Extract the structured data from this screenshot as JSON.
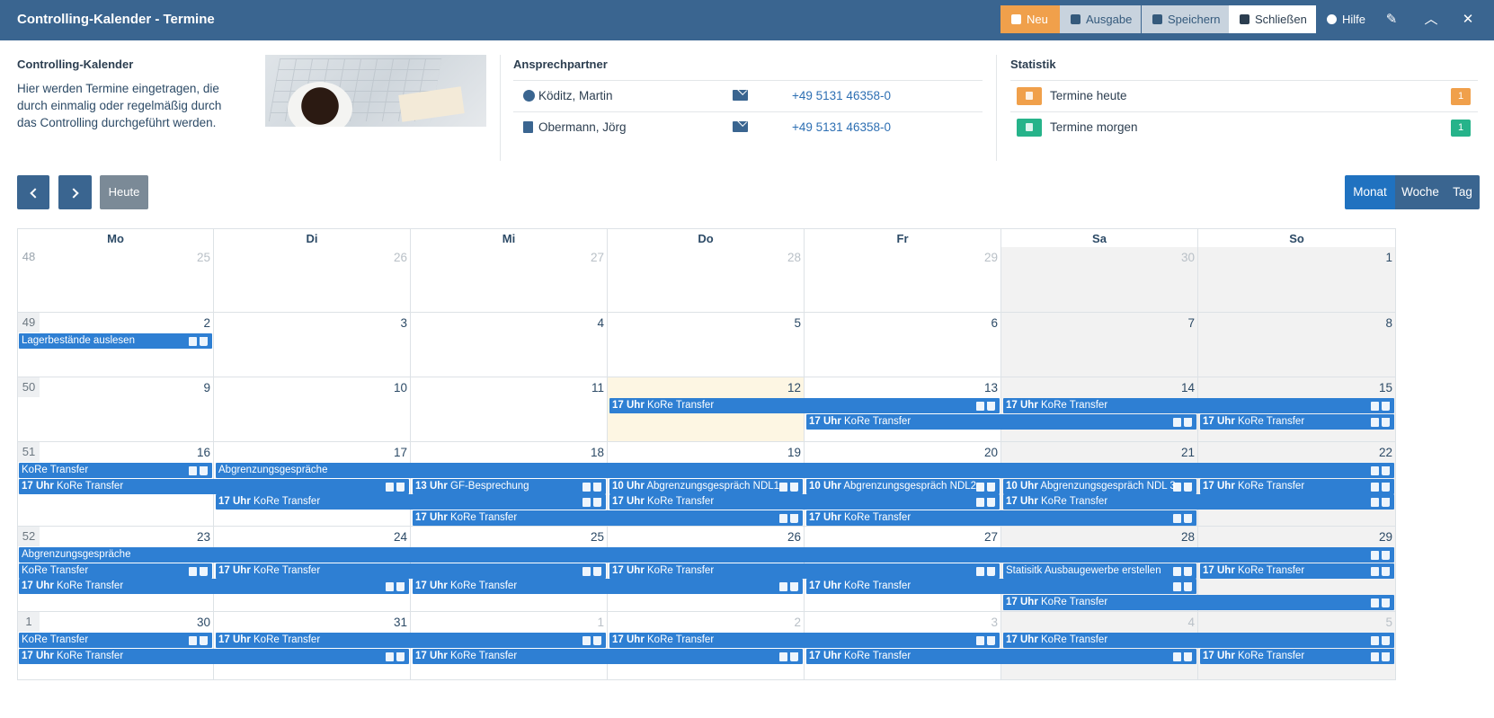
{
  "app": {
    "title": "Controlling-Kalender - Termine"
  },
  "toolbar": {
    "neu": "Neu",
    "ausgabe": "Ausgabe",
    "speichern": "Speichern",
    "schliessen": "Schließen",
    "hilfe": "Hilfe",
    "icons": [
      "pencil-icon",
      "chevron-up-icon",
      "close-icon"
    ]
  },
  "info": {
    "title": "Controlling-Kalender",
    "description": "Hier werden Termine eingetragen, die durch einmalig oder regelmäßig durch das Controlling durchgeführt werden."
  },
  "contacts": {
    "title": "Ansprechpartner",
    "items": [
      {
        "name": "Köditz, Martin",
        "phone": "+49 5131 46358-0",
        "icon": "xing-icon"
      },
      {
        "name": "Obermann, Jörg",
        "phone": "+49 5131 46358-0",
        "icon": "book-icon"
      }
    ]
  },
  "stats": {
    "title": "Statistik",
    "items": [
      {
        "label": "Termine heute",
        "count": "1",
        "color": "#f0a04b"
      },
      {
        "label": "Termine morgen",
        "count": "1",
        "color": "#26b38a"
      }
    ]
  },
  "nav": {
    "today": "Heute",
    "views": [
      "Monat",
      "Woche",
      "Tag"
    ],
    "active_view": "Monat"
  },
  "calendar": {
    "weekdays": [
      "Mo",
      "Di",
      "Mi",
      "Do",
      "Fr",
      "Sa",
      "So"
    ],
    "weeks": [
      {
        "kw": "48",
        "days": [
          "25",
          "26",
          "27",
          "28",
          "29",
          "30",
          "1"
        ],
        "other": [
          true,
          true,
          true,
          true,
          true,
          true,
          false
        ]
      },
      {
        "kw": "49",
        "days": [
          "2",
          "3",
          "4",
          "5",
          "6",
          "7",
          "8"
        ],
        "other": [
          false,
          false,
          false,
          false,
          false,
          false,
          false
        ]
      },
      {
        "kw": "50",
        "days": [
          "9",
          "10",
          "11",
          "12",
          "13",
          "14",
          "15"
        ],
        "other": [
          false,
          false,
          false,
          false,
          false,
          false,
          false
        ]
      },
      {
        "kw": "51",
        "days": [
          "16",
          "17",
          "18",
          "19",
          "20",
          "21",
          "22"
        ],
        "other": [
          false,
          false,
          false,
          false,
          false,
          false,
          false
        ]
      },
      {
        "kw": "52",
        "days": [
          "23",
          "24",
          "25",
          "26",
          "27",
          "28",
          "29"
        ],
        "other": [
          false,
          false,
          false,
          false,
          false,
          false,
          false
        ]
      },
      {
        "kw": "1",
        "days": [
          "30",
          "31",
          "1",
          "2",
          "3",
          "4",
          "5"
        ],
        "other": [
          false,
          false,
          true,
          true,
          true,
          true,
          true
        ]
      }
    ],
    "today": "12",
    "events": [
      {
        "week": 1,
        "start": 0,
        "span": 1,
        "lane": 0,
        "time": "",
        "title": "Lagerbestände auslesen"
      },
      {
        "week": 2,
        "start": 3,
        "span": 2,
        "lane": 0,
        "time": "17 Uhr",
        "title": "KoRe Transfer"
      },
      {
        "week": 2,
        "start": 5,
        "span": 2,
        "lane": 0,
        "time": "17 Uhr",
        "title": "KoRe Transfer"
      },
      {
        "week": 2,
        "start": 4,
        "span": 2,
        "lane": 1,
        "time": "17 Uhr",
        "title": "KoRe Transfer"
      },
      {
        "week": 2,
        "start": 6,
        "span": 1,
        "lane": 1,
        "time": "17 Uhr",
        "title": "KoRe Transfer"
      },
      {
        "week": 3,
        "start": 0,
        "span": 1,
        "lane": 0,
        "time": "",
        "title": "KoRe Transfer"
      },
      {
        "week": 3,
        "start": 1,
        "span": 6,
        "lane": 0,
        "time": "",
        "title": "Abgrenzungsgespräche"
      },
      {
        "week": 3,
        "start": 0,
        "span": 2,
        "lane": 1,
        "time": "17 Uhr",
        "title": "KoRe Transfer"
      },
      {
        "week": 3,
        "start": 2,
        "span": 1,
        "lane": 1,
        "time": "13 Uhr",
        "title": "GF-Besprechung"
      },
      {
        "week": 3,
        "start": 3,
        "span": 1,
        "lane": 1,
        "time": "10 Uhr",
        "title": "Abgrenzungsgespräch NDL1"
      },
      {
        "week": 3,
        "start": 4,
        "span": 1,
        "lane": 1,
        "time": "10 Uhr",
        "title": "Abgrenzungsgespräch NDL2"
      },
      {
        "week": 3,
        "start": 5,
        "span": 1,
        "lane": 1,
        "time": "10 Uhr",
        "title": "Abgrenzungsgespräch NDL 3"
      },
      {
        "week": 3,
        "start": 6,
        "span": 1,
        "lane": 1,
        "time": "17 Uhr",
        "title": "KoRe Transfer"
      },
      {
        "week": 3,
        "start": 1,
        "span": 2,
        "lane": 2,
        "time": "17 Uhr",
        "title": "KoRe Transfer"
      },
      {
        "week": 3,
        "start": 3,
        "span": 2,
        "lane": 2,
        "time": "17 Uhr",
        "title": "KoRe Transfer"
      },
      {
        "week": 3,
        "start": 5,
        "span": 2,
        "lane": 2,
        "time": "17 Uhr",
        "title": "KoRe Transfer"
      },
      {
        "week": 3,
        "start": 2,
        "span": 2,
        "lane": 3,
        "time": "17 Uhr",
        "title": "KoRe Transfer"
      },
      {
        "week": 3,
        "start": 4,
        "span": 2,
        "lane": 3,
        "time": "17 Uhr",
        "title": "KoRe Transfer"
      },
      {
        "week": 4,
        "start": 0,
        "span": 7,
        "lane": 0,
        "time": "",
        "title": "Abgrenzungsgespräche"
      },
      {
        "week": 4,
        "start": 0,
        "span": 1,
        "lane": 1,
        "time": "",
        "title": "KoRe Transfer"
      },
      {
        "week": 4,
        "start": 1,
        "span": 2,
        "lane": 1,
        "time": "17 Uhr",
        "title": "KoRe Transfer"
      },
      {
        "week": 4,
        "start": 3,
        "span": 2,
        "lane": 1,
        "time": "17 Uhr",
        "title": "KoRe Transfer"
      },
      {
        "week": 4,
        "start": 5,
        "span": 1,
        "lane": 1,
        "time": "",
        "title": "Statisitk Ausbaugewerbe erstellen"
      },
      {
        "week": 4,
        "start": 6,
        "span": 1,
        "lane": 1,
        "time": "17 Uhr",
        "title": "KoRe Transfer"
      },
      {
        "week": 4,
        "start": 0,
        "span": 2,
        "lane": 2,
        "time": "17 Uhr",
        "title": "KoRe Transfer"
      },
      {
        "week": 4,
        "start": 2,
        "span": 2,
        "lane": 2,
        "time": "17 Uhr",
        "title": "KoRe Transfer"
      },
      {
        "week": 4,
        "start": 4,
        "span": 2,
        "lane": 2,
        "time": "17 Uhr",
        "title": "KoRe Transfer"
      },
      {
        "week": 4,
        "start": 5,
        "span": 2,
        "lane": 3,
        "time": "17 Uhr",
        "title": "KoRe Transfer"
      },
      {
        "week": 5,
        "start": 0,
        "span": 1,
        "lane": 0,
        "time": "",
        "title": "KoRe Transfer"
      },
      {
        "week": 5,
        "start": 1,
        "span": 2,
        "lane": 0,
        "time": "17 Uhr",
        "title": "KoRe Transfer"
      },
      {
        "week": 5,
        "start": 3,
        "span": 2,
        "lane": 0,
        "time": "17 Uhr",
        "title": "KoRe Transfer"
      },
      {
        "week": 5,
        "start": 5,
        "span": 2,
        "lane": 0,
        "time": "17 Uhr",
        "title": "KoRe Transfer"
      },
      {
        "week": 5,
        "start": 0,
        "span": 2,
        "lane": 1,
        "time": "17 Uhr",
        "title": "KoRe Transfer"
      },
      {
        "week": 5,
        "start": 2,
        "span": 2,
        "lane": 1,
        "time": "17 Uhr",
        "title": "KoRe Transfer"
      },
      {
        "week": 5,
        "start": 4,
        "span": 2,
        "lane": 1,
        "time": "17 Uhr",
        "title": "KoRe Transfer"
      },
      {
        "week": 5,
        "start": 6,
        "span": 1,
        "lane": 1,
        "time": "17 Uhr",
        "title": "KoRe Transfer"
      }
    ]
  }
}
